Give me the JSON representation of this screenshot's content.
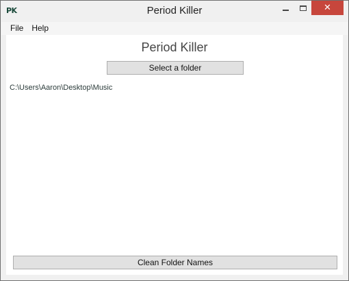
{
  "window": {
    "app_icon_text": "PK",
    "title": "Period Killer",
    "controls": {
      "minimize_icon": "minimize-icon",
      "maximize_icon": "maximize-icon",
      "close_icon": "close-icon",
      "close_glyph": "✕"
    }
  },
  "menubar": {
    "items": [
      {
        "label": "File"
      },
      {
        "label": "Help"
      }
    ]
  },
  "main": {
    "heading": "Period Killer",
    "select_folder_label": "Select a folder",
    "selected_path": "C:\\Users\\Aaron\\Desktop\\Music",
    "clean_button_label": "Clean Folder Names"
  },
  "colors": {
    "close_button": "#c7463c",
    "app_icon": "#1b4a3b",
    "button_bg": "#e1e1e1"
  }
}
